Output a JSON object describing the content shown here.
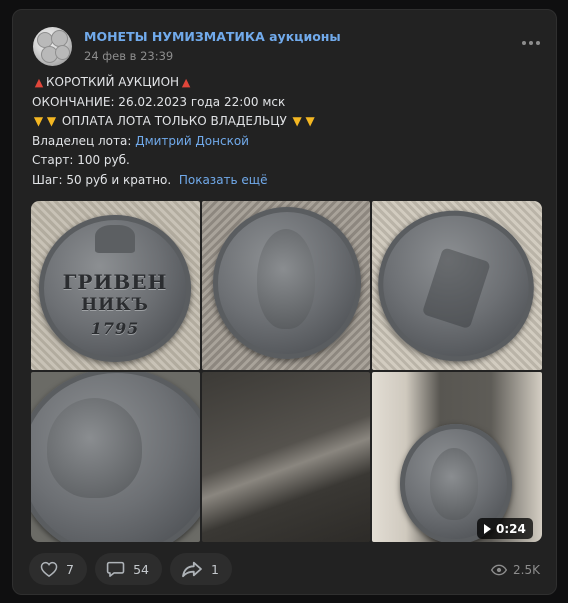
{
  "post": {
    "author": "МОНЕТЫ НУМИЗМАТИКА аукционы",
    "date": "24 фев в 23:39"
  },
  "text": {
    "line1": "КОРОТКИЙ АУКЦИОН",
    "line2": "ОКОНЧАНИЕ: 26.02.2023 года 22:00 мск",
    "line3": "ОПЛАТА ЛОТА ТОЛЬКО ВЛАДЕЛЬЦУ",
    "owner_label": "Владелец лота: ",
    "owner_name": "Дмитрий Донской",
    "start": "Старт: 100 руб.",
    "step": "Шаг: 50 руб и кратно.",
    "show_more": "Показать ещё"
  },
  "media": {
    "video_duration": "0:24",
    "coin_reverse_lines": [
      "ГРИВЕН",
      "НИКЪ",
      "1795"
    ]
  },
  "actions": {
    "likes": "7",
    "comments": "54",
    "shares": "1",
    "views": "2.5K"
  },
  "icons": {
    "pin": "pushpin-icon",
    "thumb": "thumbs-down-icon",
    "like": "heart-icon",
    "comment": "comment-icon",
    "share": "share-icon",
    "views": "eye-icon",
    "more": "more-icon",
    "play": "play-icon"
  },
  "colors": {
    "background": "#0f0f10",
    "card": "#222222",
    "link": "#71aaeb",
    "text": "#e1e3e6",
    "muted": "#8d8d8d"
  }
}
